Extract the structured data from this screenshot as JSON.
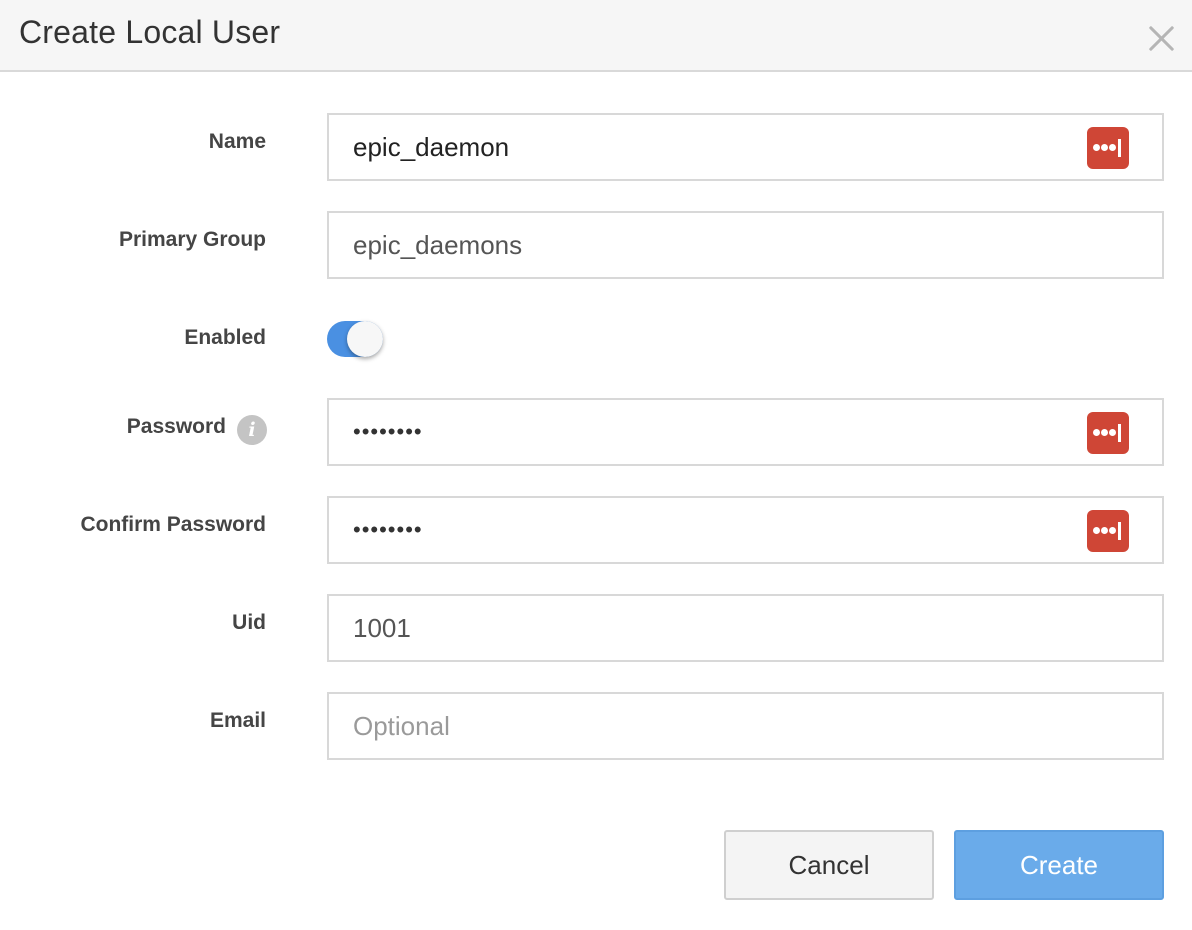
{
  "dialog": {
    "title": "Create Local User",
    "close_icon": "close-icon"
  },
  "form": {
    "name": {
      "label": "Name",
      "value": "epic_daemon"
    },
    "primary_group": {
      "label": "Primary Group",
      "value": "epic_daemons"
    },
    "enabled": {
      "label": "Enabled",
      "checked": true
    },
    "password": {
      "label": "Password",
      "value": "••••••••",
      "info_icon": "i"
    },
    "confirm_password": {
      "label": "Confirm Password",
      "value": "••••••••"
    },
    "uid": {
      "label": "Uid",
      "value": "1001"
    },
    "email": {
      "label": "Email",
      "value": "",
      "placeholder": "Optional"
    }
  },
  "buttons": {
    "cancel": "Cancel",
    "create": "Create"
  },
  "colors": {
    "toggle_on": "#4a90e2",
    "create_button": "#6aabea",
    "password_manager_icon": "#cf4636",
    "header_bg": "#f6f6f6"
  },
  "icons": {
    "password_manager": "lastpass-icon",
    "info": "info-icon",
    "close": "close-icon"
  }
}
